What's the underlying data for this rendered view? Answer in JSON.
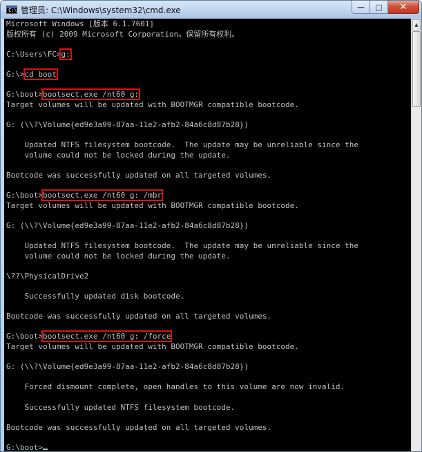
{
  "window": {
    "title": "管理员: C:\\Windows\\system32\\cmd.exe",
    "icon": "cmd-icon",
    "icon_text": "C:\\",
    "minimize": "—",
    "maximize": "□",
    "close": "✕"
  },
  "console": {
    "lines": [
      {
        "t": "Microsoft Windows [版本 6.1.7601]"
      },
      {
        "t": "版权所有 (c) 2009 Microsoft Corporation。保留所有权利。"
      },
      {
        "t": ""
      },
      {
        "t": "C:\\Users\\FC>",
        "cmd": "g:"
      },
      {
        "t": ""
      },
      {
        "t": "G:\\>",
        "cmd": "cd boot"
      },
      {
        "t": ""
      },
      {
        "t": "G:\\boot>",
        "cmd": "bootsect.exe /nt60 g:"
      },
      {
        "t": "Target volumes will be updated with BOOTMGR compatible bootcode."
      },
      {
        "t": ""
      },
      {
        "t": "G: (\\\\?\\Volume{ed9e3a99-87aa-11e2-afb2-84a6c8d87b28})"
      },
      {
        "t": ""
      },
      {
        "t": "    Updated NTFS filesystem bootcode.  The update may be unreliable since the"
      },
      {
        "t": "    volume could not be locked during the update."
      },
      {
        "t": ""
      },
      {
        "t": "Bootcode was successfully updated on all targeted volumes."
      },
      {
        "t": ""
      },
      {
        "t": "G:\\boot>",
        "cmd": "bootsect.exe /nt60 g: /mbr"
      },
      {
        "t": "Target volumes will be updated with BOOTMGR compatible bootcode."
      },
      {
        "t": ""
      },
      {
        "t": "G: (\\\\?\\Volume{ed9e3a99-87aa-11e2-afb2-84a6c8d87b28})"
      },
      {
        "t": ""
      },
      {
        "t": "    Updated NTFS filesystem bootcode.  The update may be unreliable since the"
      },
      {
        "t": "    volume could not be locked during the update."
      },
      {
        "t": ""
      },
      {
        "t": "\\??\\PhysicalDrive2"
      },
      {
        "t": ""
      },
      {
        "t": "    Successfully updated disk bootcode."
      },
      {
        "t": ""
      },
      {
        "t": "Bootcode was successfully updated on all targeted volumes."
      },
      {
        "t": ""
      },
      {
        "t": "G:\\boot>",
        "cmd": "bootsect.exe /nt60 g: /force"
      },
      {
        "t": "Target volumes will be updated with BOOTMGR compatible bootcode."
      },
      {
        "t": ""
      },
      {
        "t": "G: (\\\\?\\Volume{ed9e3a99-87aa-11e2-afb2-84a6c8d87b28})"
      },
      {
        "t": ""
      },
      {
        "t": "    Forced dismount complete, open handles to this volume are now invalid."
      },
      {
        "t": ""
      },
      {
        "t": "    Successfully updated NTFS filesystem bootcode."
      },
      {
        "t": ""
      },
      {
        "t": "Bootcode was successfully updated on all targeted volumes."
      },
      {
        "t": ""
      },
      {
        "t": "G:\\boot>",
        "cursor": true
      }
    ]
  },
  "colors": {
    "console_bg": "#000000",
    "console_text": "#c0c0c0",
    "highlight_box": "#e01010"
  }
}
